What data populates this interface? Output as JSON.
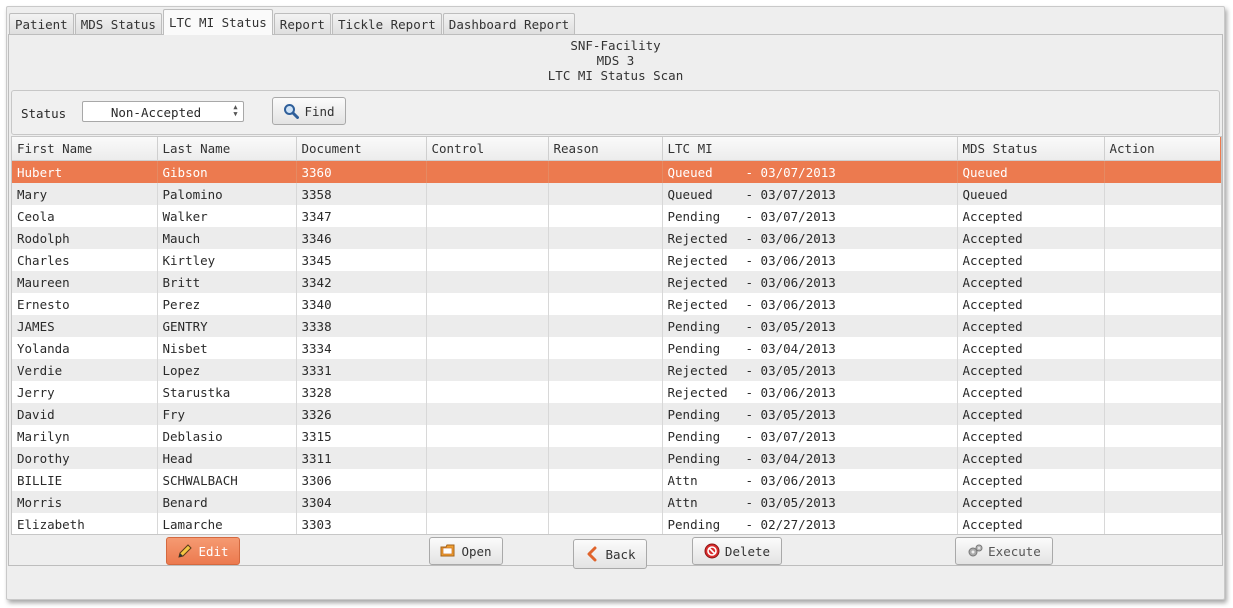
{
  "tabs": [
    "Patient",
    "MDS Status",
    "LTC MI Status",
    "Report",
    "Tickle Report",
    "Dashboard Report"
  ],
  "header": {
    "facility": "SNF-Facility",
    "mds": "MDS 3",
    "scan_title": "LTC MI Status Scan"
  },
  "filter": {
    "status_label": "Status",
    "status_value": "Non-Accepted",
    "find_label": "Find"
  },
  "table": {
    "columns": [
      "First Name",
      "Last Name",
      "Document",
      "Control",
      "Reason",
      "LTC MI",
      "MDS Status",
      "Action"
    ],
    "rows": [
      {
        "first": "Hubert",
        "last": "Gibson",
        "doc": "3360",
        "control": "",
        "reason": "",
        "ltc": "Queued",
        "date": "- 03/07/2013",
        "mds": "Queued",
        "action": ""
      },
      {
        "first": "Mary",
        "last": "Palomino",
        "doc": "3358",
        "control": "",
        "reason": "",
        "ltc": "Queued",
        "date": "- 03/07/2013",
        "mds": "Queued",
        "action": ""
      },
      {
        "first": "Ceola",
        "last": "Walker",
        "doc": "3347",
        "control": "",
        "reason": "",
        "ltc": "Pending",
        "date": "- 03/07/2013",
        "mds": "Accepted",
        "action": ""
      },
      {
        "first": "Rodolph",
        "last": "Mauch",
        "doc": "3346",
        "control": "",
        "reason": "",
        "ltc": "Rejected",
        "date": "- 03/06/2013",
        "mds": "Accepted",
        "action": ""
      },
      {
        "first": "Charles",
        "last": "Kirtley",
        "doc": "3345",
        "control": "",
        "reason": "",
        "ltc": "Rejected",
        "date": "- 03/06/2013",
        "mds": "Accepted",
        "action": ""
      },
      {
        "first": "Maureen",
        "last": "Britt",
        "doc": "3342",
        "control": "",
        "reason": "",
        "ltc": "Rejected",
        "date": "- 03/06/2013",
        "mds": "Accepted",
        "action": ""
      },
      {
        "first": "Ernesto",
        "last": "Perez",
        "doc": "3340",
        "control": "",
        "reason": "",
        "ltc": "Rejected",
        "date": "- 03/06/2013",
        "mds": "Accepted",
        "action": ""
      },
      {
        "first": "JAMES",
        "last": "GENTRY",
        "doc": "3338",
        "control": "",
        "reason": "",
        "ltc": "Pending",
        "date": "- 03/05/2013",
        "mds": "Accepted",
        "action": ""
      },
      {
        "first": "Yolanda",
        "last": "Nisbet",
        "doc": "3334",
        "control": "",
        "reason": "",
        "ltc": "Pending",
        "date": "- 03/04/2013",
        "mds": "Accepted",
        "action": ""
      },
      {
        "first": "Verdie",
        "last": "Lopez",
        "doc": "3331",
        "control": "",
        "reason": "",
        "ltc": "Rejected",
        "date": "- 03/05/2013",
        "mds": "Accepted",
        "action": ""
      },
      {
        "first": "Jerry",
        "last": "Starustka",
        "doc": "3328",
        "control": "",
        "reason": "",
        "ltc": "Rejected",
        "date": "- 03/06/2013",
        "mds": "Accepted",
        "action": ""
      },
      {
        "first": "David",
        "last": "Fry",
        "doc": "3326",
        "control": "",
        "reason": "",
        "ltc": "Pending",
        "date": "- 03/05/2013",
        "mds": "Accepted",
        "action": ""
      },
      {
        "first": "Marilyn",
        "last": "Deblasio",
        "doc": "3315",
        "control": "",
        "reason": "",
        "ltc": "Pending",
        "date": "- 03/07/2013",
        "mds": "Accepted",
        "action": ""
      },
      {
        "first": "Dorothy",
        "last": "Head",
        "doc": "3311",
        "control": "",
        "reason": "",
        "ltc": "Pending",
        "date": "- 03/04/2013",
        "mds": "Accepted",
        "action": ""
      },
      {
        "first": "BILLIE",
        "last": "SCHWALBACH",
        "doc": "3306",
        "control": "",
        "reason": "",
        "ltc": "Attn",
        "date": "- 03/06/2013",
        "mds": "Accepted",
        "action": ""
      },
      {
        "first": "Morris",
        "last": "Benard",
        "doc": "3304",
        "control": "",
        "reason": "",
        "ltc": "Attn",
        "date": "- 03/05/2013",
        "mds": "Accepted",
        "action": ""
      },
      {
        "first": "Elizabeth",
        "last": "Lamarche",
        "doc": "3303",
        "control": "",
        "reason": "",
        "ltc": "Pending",
        "date": "- 02/27/2013",
        "mds": "Accepted",
        "action": ""
      }
    ]
  },
  "actions": {
    "edit": "Edit",
    "open": "Open",
    "delete": "Delete",
    "execute": "Execute",
    "back": "Back"
  },
  "colors": {
    "accent": "#ec7a4f",
    "row_alt": "#ececec"
  },
  "icons": {
    "find": "magnifier-icon",
    "edit": "pencil-icon",
    "open": "folder-icon",
    "delete": "no-entry-icon",
    "execute": "gears-icon",
    "back": "back-arrow-icon"
  }
}
